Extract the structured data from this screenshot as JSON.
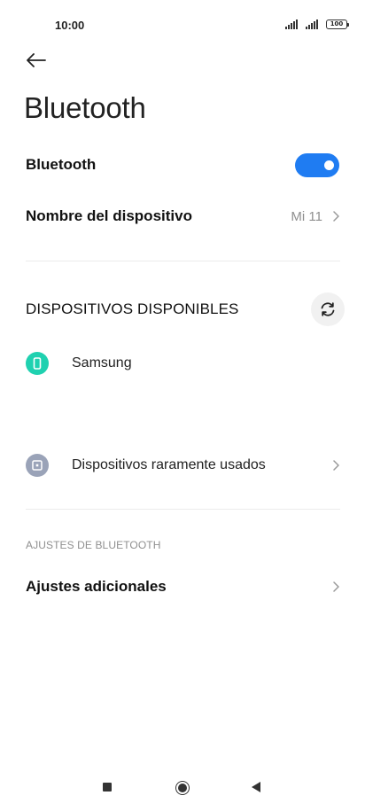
{
  "status_bar": {
    "time": "10:00",
    "battery": "100"
  },
  "header": {
    "title": "Bluetooth"
  },
  "bluetooth_toggle": {
    "label": "Bluetooth",
    "enabled": true
  },
  "device_name": {
    "label": "Nombre del dispositivo",
    "value": "Mi 11"
  },
  "available_devices": {
    "heading": "DISPOSITIVOS DISPONIBLES",
    "items": [
      {
        "label": "Samsung",
        "icon": "phone-icon"
      }
    ]
  },
  "rarely_used": {
    "label": "Dispositivos raramente usados",
    "icon": "device-box-icon"
  },
  "settings_section": {
    "heading": "AJUSTES DE BLUETOOTH",
    "additional_label": "Ajustes adicionales"
  },
  "colors": {
    "accent": "#1f7cf2",
    "device_icon": "#1fd1b0",
    "rare_icon": "#9aa3b8"
  }
}
